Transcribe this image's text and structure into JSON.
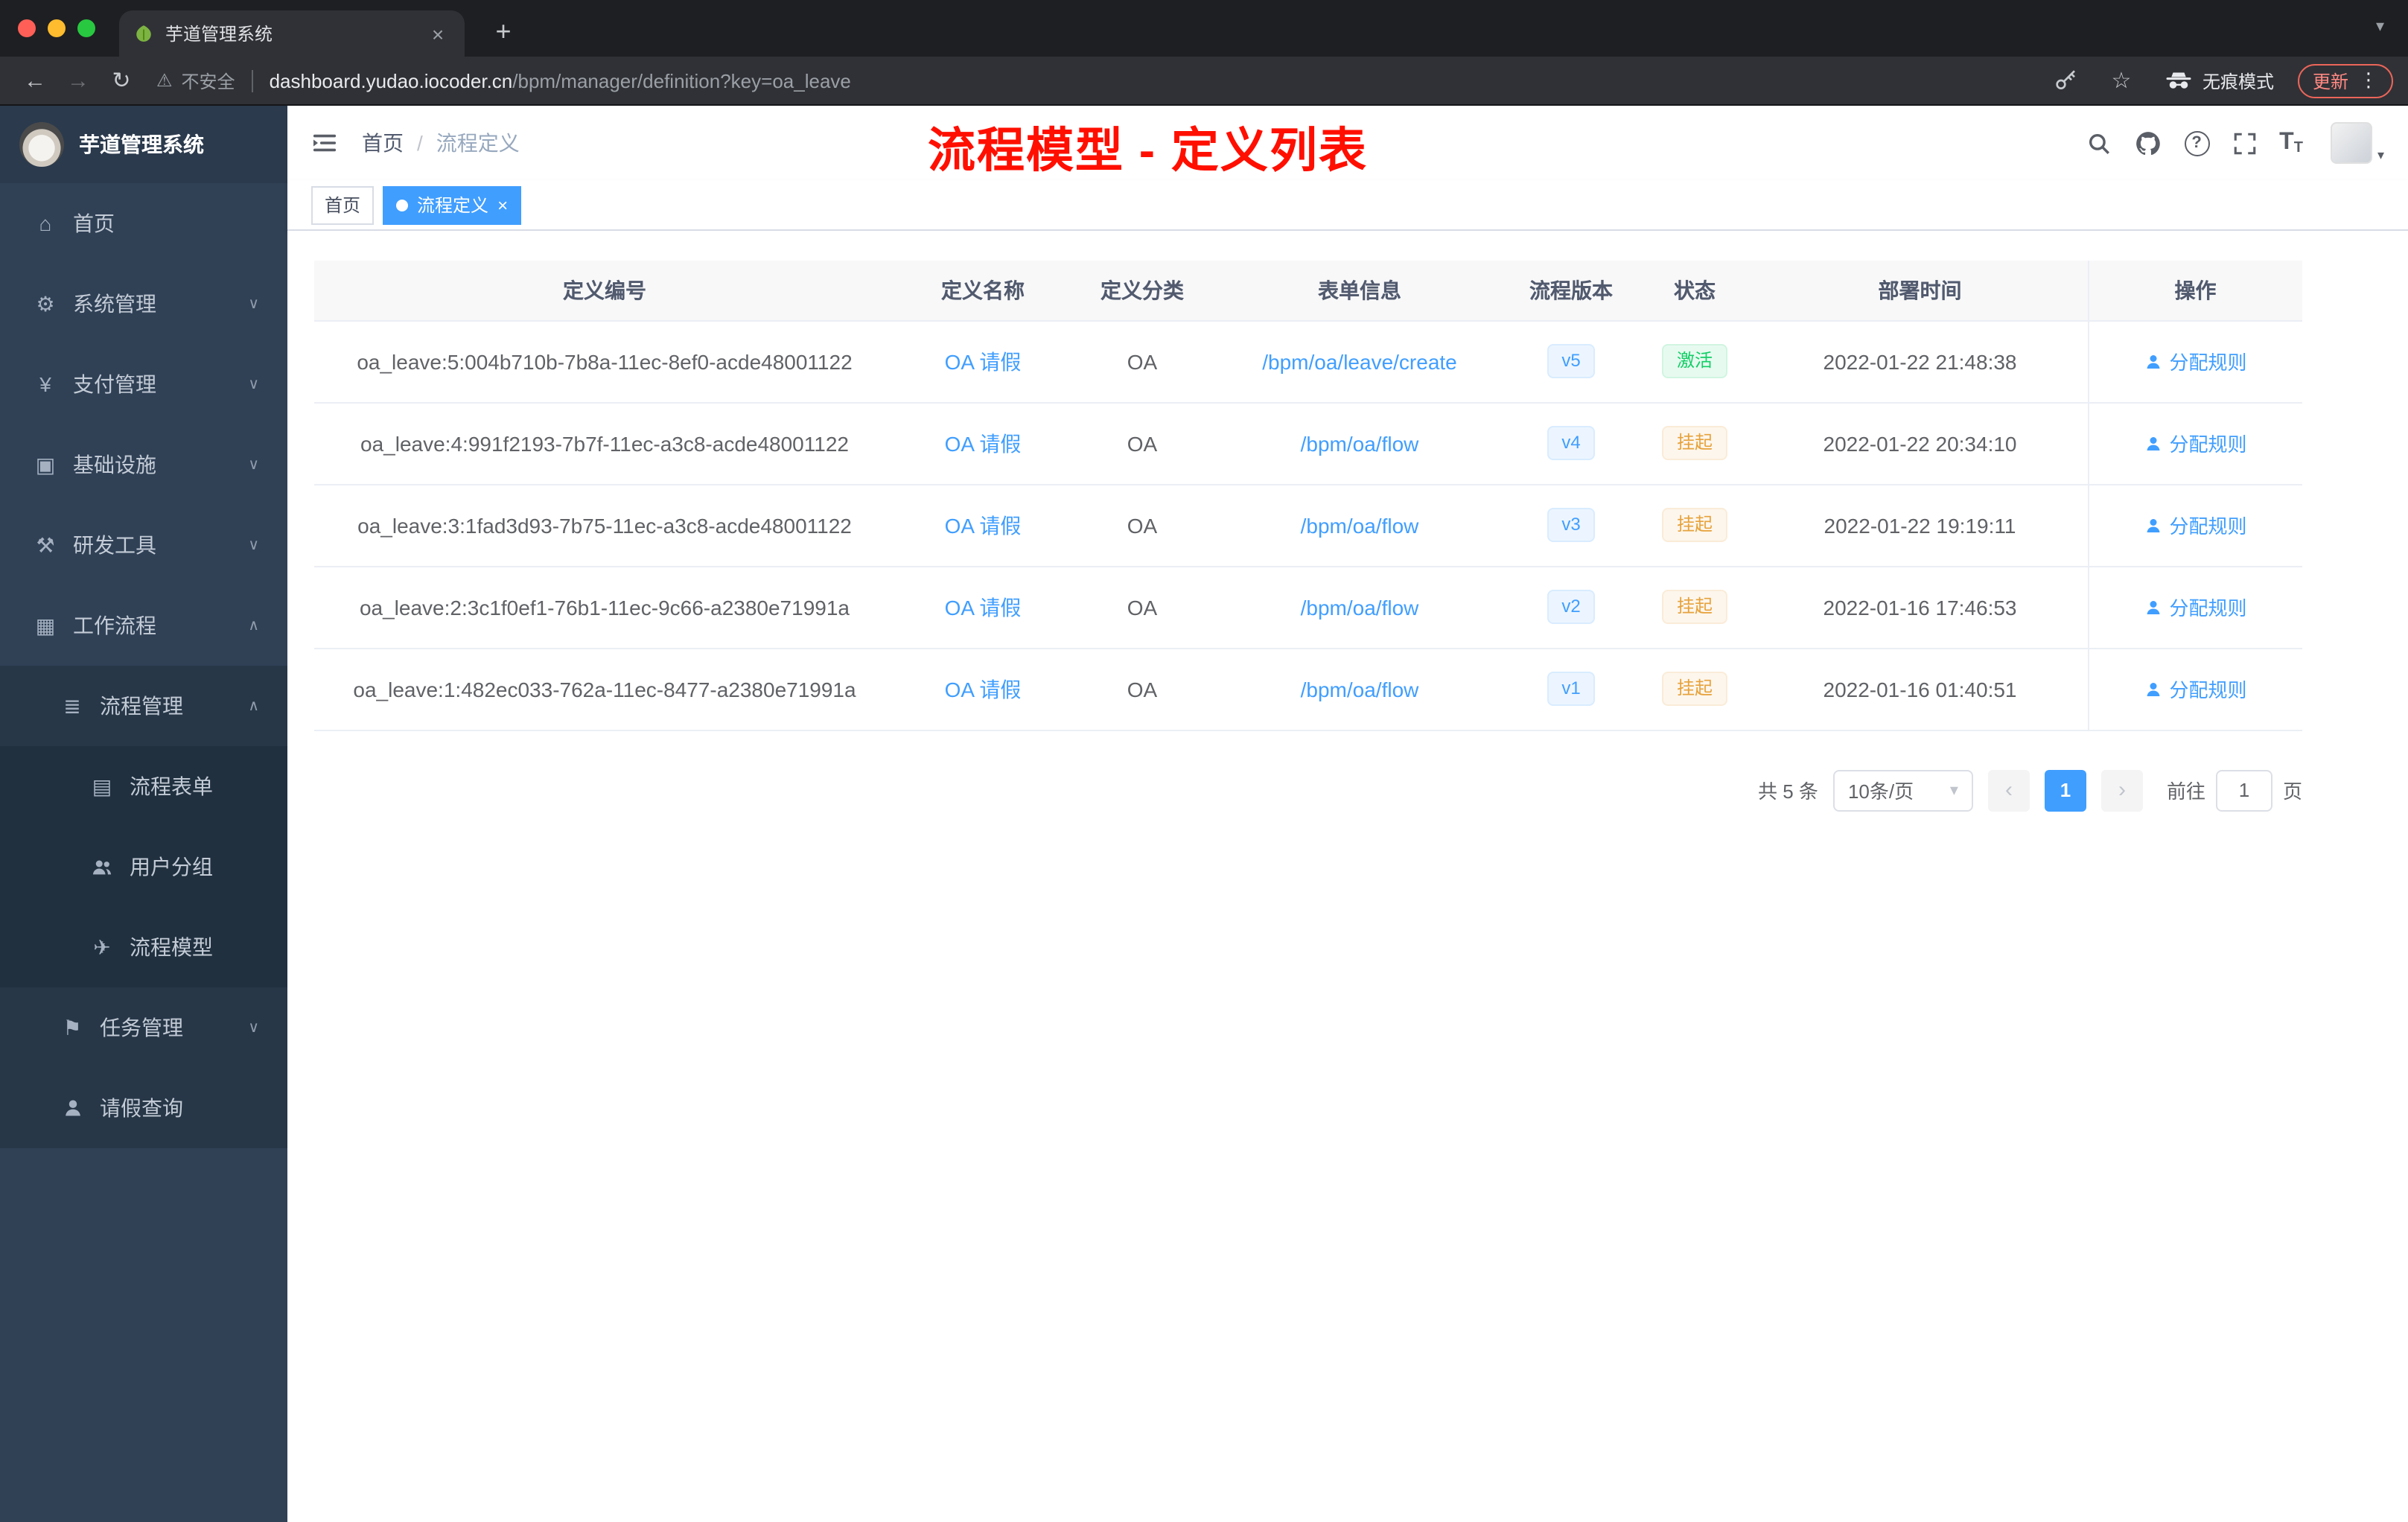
{
  "browser": {
    "tab_title": "芋道管理系统",
    "security_label": "不安全",
    "url_host": "dashboard.yudao.iocoder.cn",
    "url_path": "/bpm/manager/definition?key=oa_leave",
    "incognito_label": "无痕模式",
    "update_label": "更新"
  },
  "icons": {
    "home": "⌂",
    "system": "⚙",
    "payment": "¥",
    "infra": "▣",
    "devtools": "⚒",
    "workflow": "▦",
    "process_mgmt": "≣",
    "form": "▤",
    "model": "✈",
    "task": "⚑",
    "back": "←",
    "forward": "→",
    "reload": "↻",
    "warning": "⚠",
    "star": "☆",
    "plus": "+",
    "close": "×",
    "kebab": "⋮",
    "slash": "/",
    "chevron_down": "∨",
    "chevron_up": "∧",
    "caret_down": "▾",
    "question": "?",
    "font_big": "T",
    "font_small": "T",
    "prev": "‹",
    "next": "›"
  },
  "sidebar": {
    "logo_title": "芋道管理系统",
    "items": [
      {
        "label": "首页"
      },
      {
        "label": "系统管理"
      },
      {
        "label": "支付管理"
      },
      {
        "label": "基础设施"
      },
      {
        "label": "研发工具"
      },
      {
        "label": "工作流程"
      },
      {
        "label": "流程管理"
      },
      {
        "label": "流程表单"
      },
      {
        "label": "用户分组"
      },
      {
        "label": "流程模型"
      },
      {
        "label": "任务管理"
      },
      {
        "label": "请假查询"
      }
    ]
  },
  "header": {
    "breadcrumb": [
      "首页",
      "流程定义"
    ],
    "annotation": "流程模型 - 定义列表"
  },
  "tags": [
    {
      "label": "首页"
    },
    {
      "label": "流程定义"
    }
  ],
  "table": {
    "columns": [
      "定义编号",
      "定义名称",
      "定义分类",
      "表单信息",
      "流程版本",
      "状态",
      "部署时间",
      "操作"
    ],
    "action_label": "分配规则",
    "rows": [
      {
        "id": "oa_leave:5:004b710b-7b8a-11ec-8ef0-acde48001122",
        "name": "OA 请假",
        "category": "OA",
        "form": "/bpm/oa/leave/create",
        "version": "v5",
        "status": "激活",
        "time": "2022-01-22 21:48:38"
      },
      {
        "id": "oa_leave:4:991f2193-7b7f-11ec-a3c8-acde48001122",
        "name": "OA 请假",
        "category": "OA",
        "form": "/bpm/oa/flow",
        "version": "v4",
        "status": "挂起",
        "time": "2022-01-22 20:34:10"
      },
      {
        "id": "oa_leave:3:1fad3d93-7b75-11ec-a3c8-acde48001122",
        "name": "OA 请假",
        "category": "OA",
        "form": "/bpm/oa/flow",
        "version": "v3",
        "status": "挂起",
        "time": "2022-01-22 19:19:11"
      },
      {
        "id": "oa_leave:2:3c1f0ef1-76b1-11ec-9c66-a2380e71991a",
        "name": "OA 请假",
        "category": "OA",
        "form": "/bpm/oa/flow",
        "version": "v2",
        "status": "挂起",
        "time": "2022-01-16 17:46:53"
      },
      {
        "id": "oa_leave:1:482ec033-762a-11ec-8477-a2380e71991a",
        "name": "OA 请假",
        "category": "OA",
        "form": "/bpm/oa/flow",
        "version": "v1",
        "status": "挂起",
        "time": "2022-01-16 01:40:51"
      }
    ]
  },
  "pagination": {
    "total": "共 5 条",
    "page_size": "10条/页",
    "current_page": "1",
    "goto_label": "前往",
    "goto_value": "1",
    "page_unit": "页"
  }
}
